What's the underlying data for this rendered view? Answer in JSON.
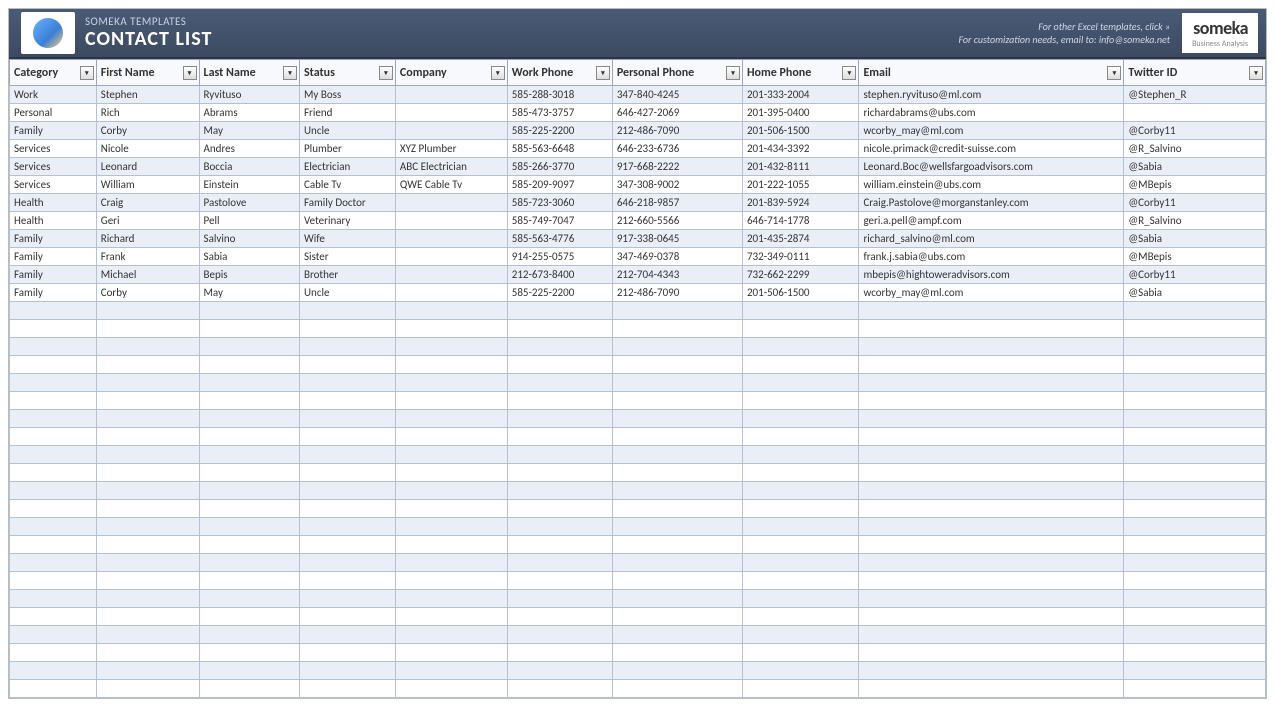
{
  "header": {
    "subtitle": "SOMEKA TEMPLATES",
    "title": "CONTACT LIST",
    "note_line1": "For other Excel templates, click »",
    "note_line2": "For customization needs, email to: info@someka.net",
    "logo_main": "someka",
    "logo_sub": "Business Analysis"
  },
  "columns": [
    {
      "key": "category",
      "label": "Category",
      "cls": "col-category"
    },
    {
      "key": "first_name",
      "label": "First Name",
      "cls": "col-first"
    },
    {
      "key": "last_name",
      "label": "Last Name",
      "cls": "col-last"
    },
    {
      "key": "status",
      "label": "Status",
      "cls": "col-status"
    },
    {
      "key": "company",
      "label": "Company",
      "cls": "col-company"
    },
    {
      "key": "work_phone",
      "label": "Work Phone",
      "cls": "col-workphone"
    },
    {
      "key": "personal_phone",
      "label": "Personal Phone",
      "cls": "col-persphone"
    },
    {
      "key": "home_phone",
      "label": "Home Phone",
      "cls": "col-homephone"
    },
    {
      "key": "email",
      "label": "Email",
      "cls": "col-email"
    },
    {
      "key": "twitter",
      "label": "Twitter ID",
      "cls": "col-twitter"
    }
  ],
  "rows": [
    {
      "category": "Work",
      "first_name": "Stephen",
      "last_name": "Ryvituso",
      "status": "My Boss",
      "company": "",
      "work_phone": "585-288-3018",
      "personal_phone": "347-840-4245",
      "home_phone": "201-333-2004",
      "email": "stephen.ryvituso@ml.com",
      "twitter": "@Stephen_R"
    },
    {
      "category": "Personal",
      "first_name": "Rich",
      "last_name": "Abrams",
      "status": "Friend",
      "company": "",
      "work_phone": "585-473-3757",
      "personal_phone": "646-427-2069",
      "home_phone": "201-395-0400",
      "email": "richardabrams@ubs.com",
      "twitter": ""
    },
    {
      "category": "Family",
      "first_name": "Corby",
      "last_name": "May",
      "status": "Uncle",
      "company": "",
      "work_phone": "585-225-2200",
      "personal_phone": "212-486-7090",
      "home_phone": "201-506-1500",
      "email": "wcorby_may@ml.com",
      "twitter": "@Corby11"
    },
    {
      "category": "Services",
      "first_name": "Nicole",
      "last_name": "Andres",
      "status": "Plumber",
      "company": "XYZ Plumber",
      "work_phone": "585-563-6648",
      "personal_phone": "646-233-6736",
      "home_phone": "201-434-3392",
      "email": "nicole.primack@credit-suisse.com",
      "twitter": "@R_Salvino"
    },
    {
      "category": "Services",
      "first_name": "Leonard",
      "last_name": "Boccia",
      "status": "Electrician",
      "company": "ABC Electrician",
      "work_phone": "585-266-3770",
      "personal_phone": "917-668-2222",
      "home_phone": "201-432-8111",
      "email": "Leonard.Boc@wellsfargoadvisors.com",
      "twitter": "@Sabia"
    },
    {
      "category": "Services",
      "first_name": "William",
      "last_name": "Einstein",
      "status": "Cable Tv",
      "company": "QWE Cable Tv",
      "work_phone": "585-209-9097",
      "personal_phone": "347-308-9002",
      "home_phone": "201-222-1055",
      "email": "william.einstein@ubs.com",
      "twitter": "@MBepis"
    },
    {
      "category": "Health",
      "first_name": "Craig",
      "last_name": "Pastolove",
      "status": "Family Doctor",
      "company": "",
      "work_phone": "585-723-3060",
      "personal_phone": "646-218-9857",
      "home_phone": "201-839-5924",
      "email": "Craig.Pastolove@morganstanley.com",
      "twitter": "@Corby11"
    },
    {
      "category": "Health",
      "first_name": "Geri",
      "last_name": "Pell",
      "status": "Veterinary",
      "company": "",
      "work_phone": "585-749-7047",
      "personal_phone": "212-660-5566",
      "home_phone": "646-714-1778",
      "email": "geri.a.pell@ampf.com",
      "twitter": "@R_Salvino"
    },
    {
      "category": "Family",
      "first_name": "Richard",
      "last_name": "Salvino",
      "status": "Wife",
      "company": "",
      "work_phone": "585-563-4776",
      "personal_phone": "917-338-0645",
      "home_phone": "201-435-2874",
      "email": "richard_salvino@ml.com",
      "twitter": "@Sabia"
    },
    {
      "category": "Family",
      "first_name": "Frank",
      "last_name": "Sabia",
      "status": "Sister",
      "company": "",
      "work_phone": "914-255-0575",
      "personal_phone": "347-469-0378",
      "home_phone": "732-349-0111",
      "email": "frank.j.sabia@ubs.com",
      "twitter": "@MBepis"
    },
    {
      "category": "Family",
      "first_name": "Michael",
      "last_name": "Bepis",
      "status": "Brother",
      "company": "",
      "work_phone": "212-673-8400",
      "personal_phone": "212-704-4343",
      "home_phone": "732-662-2299",
      "email": "mbepis@hightoweradvisors.com",
      "twitter": "@Corby11"
    },
    {
      "category": "Family",
      "first_name": "Corby",
      "last_name": "May",
      "status": "Uncle",
      "company": "",
      "work_phone": "585-225-2200",
      "personal_phone": "212-486-7090",
      "home_phone": "201-506-1500",
      "email": "wcorby_may@ml.com",
      "twitter": "@Sabia"
    }
  ],
  "empty_rows": 22
}
